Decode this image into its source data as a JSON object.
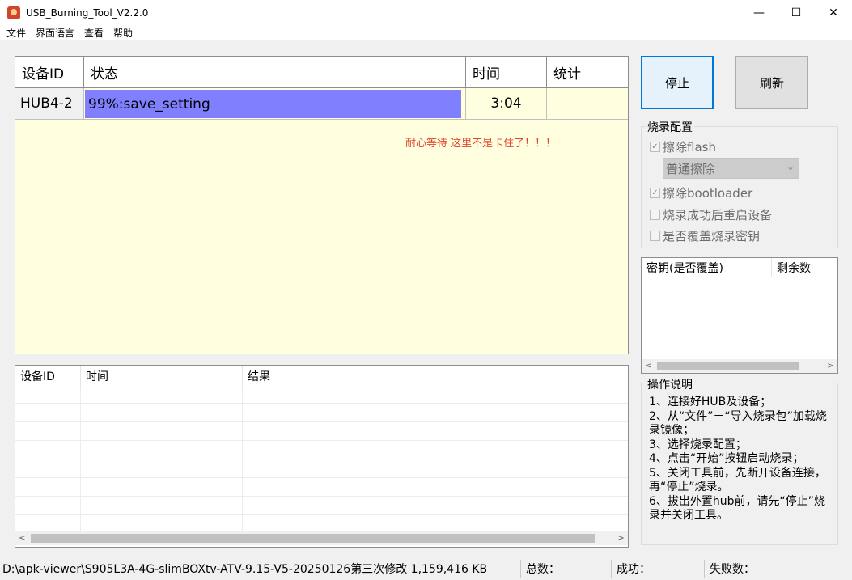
{
  "window": {
    "title": "USB_Burning_Tool_V2.2.0",
    "minimize_glyph": "—",
    "maximize_glyph": "☐",
    "close_glyph": "✕"
  },
  "menu": [
    "文件",
    "界面语言",
    "查看",
    "帮助"
  ],
  "device_list": {
    "headers": [
      "设备ID",
      "状态",
      "时间",
      "统计"
    ],
    "rows": [
      {
        "device_id": "HUB4-2",
        "status": "99%:save_setting",
        "progress": 0.99,
        "time": "3:04",
        "stats": ""
      }
    ],
    "progress_color": "#8080ff",
    "notice": "耐心等待   这里不是卡住了！！！",
    "notice_color": "#e0462f",
    "background": "#ffffe0"
  },
  "buttons": {
    "stop": "停止",
    "refresh": "刷新"
  },
  "burn_config": {
    "title": "烧录配置",
    "erase_flash": {
      "label": "擦除flash",
      "checked": true
    },
    "erase_mode": "普通擦除",
    "erase_bootloader": {
      "label": "擦除bootloader",
      "checked": true
    },
    "reboot_after": {
      "label": "烧录成功后重启设备",
      "checked": false
    },
    "overwrite_keys": {
      "label": "是否覆盖烧录密钥",
      "checked": false
    }
  },
  "key_list": {
    "headers": [
      "密钥(是否覆盖)",
      "剩余数"
    ]
  },
  "instructions": {
    "title": "操作说明",
    "lines": [
      "1、连接好HUB及设备；",
      "2、从“文件”－“导入烧录包”加载烧录镜像；",
      "3、选择烧录配置；",
      "4、点击“开始”按钮启动烧录；",
      "5、关闭工具前，先断开设备连接，再“停止”烧录。",
      "6、拔出外置hub前，请先“停止”烧录并关闭工具。"
    ]
  },
  "log_list": {
    "headers": [
      "设备ID",
      "时间",
      "结果"
    ]
  },
  "status_bar": {
    "file": "D:\\apk-viewer\\S905L3A-4G-slimBOXtv-ATV-9.15-V5-20250126第三次修改 1,159,416 KB",
    "total": "总数：",
    "success": "成功：",
    "failed": "失败数："
  }
}
